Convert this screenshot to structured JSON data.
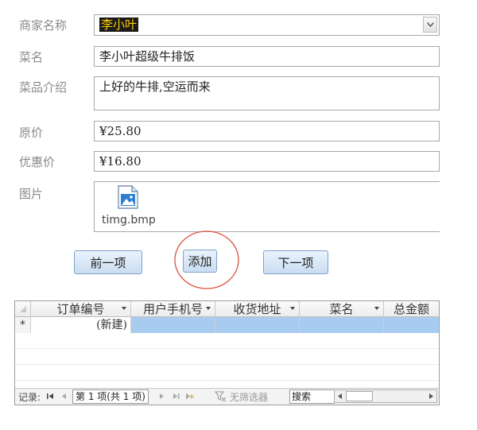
{
  "form": {
    "merchant_label": "商家名称",
    "merchant_value": "李小叶",
    "dish_label": "菜名",
    "dish_value": "李小叶超级牛排饭",
    "intro_label": "菜品介绍",
    "intro_value": "上好的牛排,空运而来",
    "price_label": "原价",
    "price_value": "¥25.80",
    "discount_label": "优惠价",
    "discount_value": "¥16.80",
    "image_label": "图片",
    "image_file": "timg.bmp"
  },
  "buttons": {
    "prev": "前一项",
    "add": "添加",
    "next": "下一项"
  },
  "grid": {
    "columns": [
      "订单编号",
      "用户手机号",
      "收货地址",
      "菜名",
      "总金额"
    ],
    "new_row_marker": "*",
    "new_row_text": "(新建)"
  },
  "record_nav": {
    "label": "记录:",
    "position": "第 1 项(共 1 项)",
    "filter": "无筛选器",
    "search": "搜索"
  },
  "colors": {
    "annotation_circle": "#e05040",
    "selected_row": "#a8cbf0",
    "button_border": "#7da2c8"
  }
}
